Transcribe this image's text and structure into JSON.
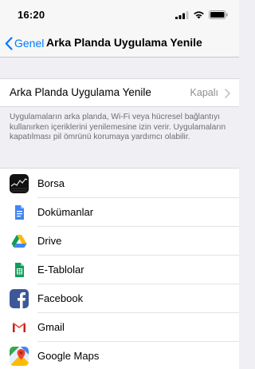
{
  "status_bar": {
    "time": "16:20"
  },
  "nav": {
    "back_label": "Genel",
    "title": "Arka Planda Uygulama Yenile"
  },
  "setting": {
    "label": "Arka Planda Uygulama Yenile",
    "value": "Kapalı"
  },
  "footnote": "Uygulamaların arka planda, Wi-Fi veya hücresel bağlantıyı kullanırken içeriklerini yenilemesine izin verir. Uygulamaların kapatılması pil ömrünü korumaya yardımcı olabilir.",
  "apps": [
    {
      "name": "Borsa",
      "icon": "stocks-icon"
    },
    {
      "name": "Dokümanlar",
      "icon": "google-docs-icon"
    },
    {
      "name": "Drive",
      "icon": "google-drive-icon"
    },
    {
      "name": "E-Tablolar",
      "icon": "google-sheets-icon"
    },
    {
      "name": "Facebook",
      "icon": "facebook-icon"
    },
    {
      "name": "Gmail",
      "icon": "gmail-icon"
    },
    {
      "name": "Google Maps",
      "icon": "google-maps-icon"
    }
  ],
  "colors": {
    "accent": "#007aff",
    "background": "#efeff4",
    "secondary_text": "#8e8e93"
  }
}
